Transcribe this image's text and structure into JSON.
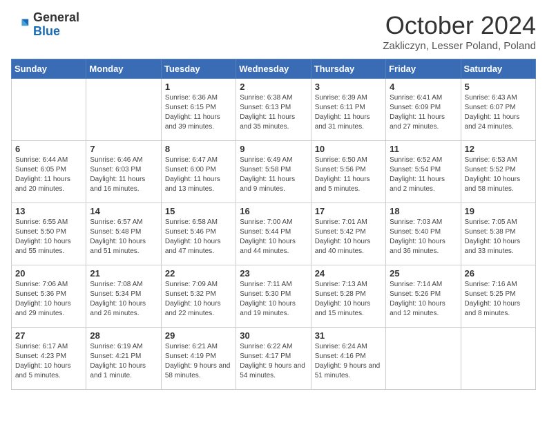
{
  "header": {
    "logo_general": "General",
    "logo_blue": "Blue",
    "month_title": "October 2024",
    "location": "Zakliczyn, Lesser Poland, Poland"
  },
  "days_of_week": [
    "Sunday",
    "Monday",
    "Tuesday",
    "Wednesday",
    "Thursday",
    "Friday",
    "Saturday"
  ],
  "weeks": [
    [
      {
        "day": "",
        "info": ""
      },
      {
        "day": "",
        "info": ""
      },
      {
        "day": "1",
        "info": "Sunrise: 6:36 AM\nSunset: 6:15 PM\nDaylight: 11 hours and 39 minutes."
      },
      {
        "day": "2",
        "info": "Sunrise: 6:38 AM\nSunset: 6:13 PM\nDaylight: 11 hours and 35 minutes."
      },
      {
        "day": "3",
        "info": "Sunrise: 6:39 AM\nSunset: 6:11 PM\nDaylight: 11 hours and 31 minutes."
      },
      {
        "day": "4",
        "info": "Sunrise: 6:41 AM\nSunset: 6:09 PM\nDaylight: 11 hours and 27 minutes."
      },
      {
        "day": "5",
        "info": "Sunrise: 6:43 AM\nSunset: 6:07 PM\nDaylight: 11 hours and 24 minutes."
      }
    ],
    [
      {
        "day": "6",
        "info": "Sunrise: 6:44 AM\nSunset: 6:05 PM\nDaylight: 11 hours and 20 minutes."
      },
      {
        "day": "7",
        "info": "Sunrise: 6:46 AM\nSunset: 6:03 PM\nDaylight: 11 hours and 16 minutes."
      },
      {
        "day": "8",
        "info": "Sunrise: 6:47 AM\nSunset: 6:00 PM\nDaylight: 11 hours and 13 minutes."
      },
      {
        "day": "9",
        "info": "Sunrise: 6:49 AM\nSunset: 5:58 PM\nDaylight: 11 hours and 9 minutes."
      },
      {
        "day": "10",
        "info": "Sunrise: 6:50 AM\nSunset: 5:56 PM\nDaylight: 11 hours and 5 minutes."
      },
      {
        "day": "11",
        "info": "Sunrise: 6:52 AM\nSunset: 5:54 PM\nDaylight: 11 hours and 2 minutes."
      },
      {
        "day": "12",
        "info": "Sunrise: 6:53 AM\nSunset: 5:52 PM\nDaylight: 10 hours and 58 minutes."
      }
    ],
    [
      {
        "day": "13",
        "info": "Sunrise: 6:55 AM\nSunset: 5:50 PM\nDaylight: 10 hours and 55 minutes."
      },
      {
        "day": "14",
        "info": "Sunrise: 6:57 AM\nSunset: 5:48 PM\nDaylight: 10 hours and 51 minutes."
      },
      {
        "day": "15",
        "info": "Sunrise: 6:58 AM\nSunset: 5:46 PM\nDaylight: 10 hours and 47 minutes."
      },
      {
        "day": "16",
        "info": "Sunrise: 7:00 AM\nSunset: 5:44 PM\nDaylight: 10 hours and 44 minutes."
      },
      {
        "day": "17",
        "info": "Sunrise: 7:01 AM\nSunset: 5:42 PM\nDaylight: 10 hours and 40 minutes."
      },
      {
        "day": "18",
        "info": "Sunrise: 7:03 AM\nSunset: 5:40 PM\nDaylight: 10 hours and 36 minutes."
      },
      {
        "day": "19",
        "info": "Sunrise: 7:05 AM\nSunset: 5:38 PM\nDaylight: 10 hours and 33 minutes."
      }
    ],
    [
      {
        "day": "20",
        "info": "Sunrise: 7:06 AM\nSunset: 5:36 PM\nDaylight: 10 hours and 29 minutes."
      },
      {
        "day": "21",
        "info": "Sunrise: 7:08 AM\nSunset: 5:34 PM\nDaylight: 10 hours and 26 minutes."
      },
      {
        "day": "22",
        "info": "Sunrise: 7:09 AM\nSunset: 5:32 PM\nDaylight: 10 hours and 22 minutes."
      },
      {
        "day": "23",
        "info": "Sunrise: 7:11 AM\nSunset: 5:30 PM\nDaylight: 10 hours and 19 minutes."
      },
      {
        "day": "24",
        "info": "Sunrise: 7:13 AM\nSunset: 5:28 PM\nDaylight: 10 hours and 15 minutes."
      },
      {
        "day": "25",
        "info": "Sunrise: 7:14 AM\nSunset: 5:26 PM\nDaylight: 10 hours and 12 minutes."
      },
      {
        "day": "26",
        "info": "Sunrise: 7:16 AM\nSunset: 5:25 PM\nDaylight: 10 hours and 8 minutes."
      }
    ],
    [
      {
        "day": "27",
        "info": "Sunrise: 6:17 AM\nSunset: 4:23 PM\nDaylight: 10 hours and 5 minutes."
      },
      {
        "day": "28",
        "info": "Sunrise: 6:19 AM\nSunset: 4:21 PM\nDaylight: 10 hours and 1 minute."
      },
      {
        "day": "29",
        "info": "Sunrise: 6:21 AM\nSunset: 4:19 PM\nDaylight: 9 hours and 58 minutes."
      },
      {
        "day": "30",
        "info": "Sunrise: 6:22 AM\nSunset: 4:17 PM\nDaylight: 9 hours and 54 minutes."
      },
      {
        "day": "31",
        "info": "Sunrise: 6:24 AM\nSunset: 4:16 PM\nDaylight: 9 hours and 51 minutes."
      },
      {
        "day": "",
        "info": ""
      },
      {
        "day": "",
        "info": ""
      }
    ]
  ]
}
